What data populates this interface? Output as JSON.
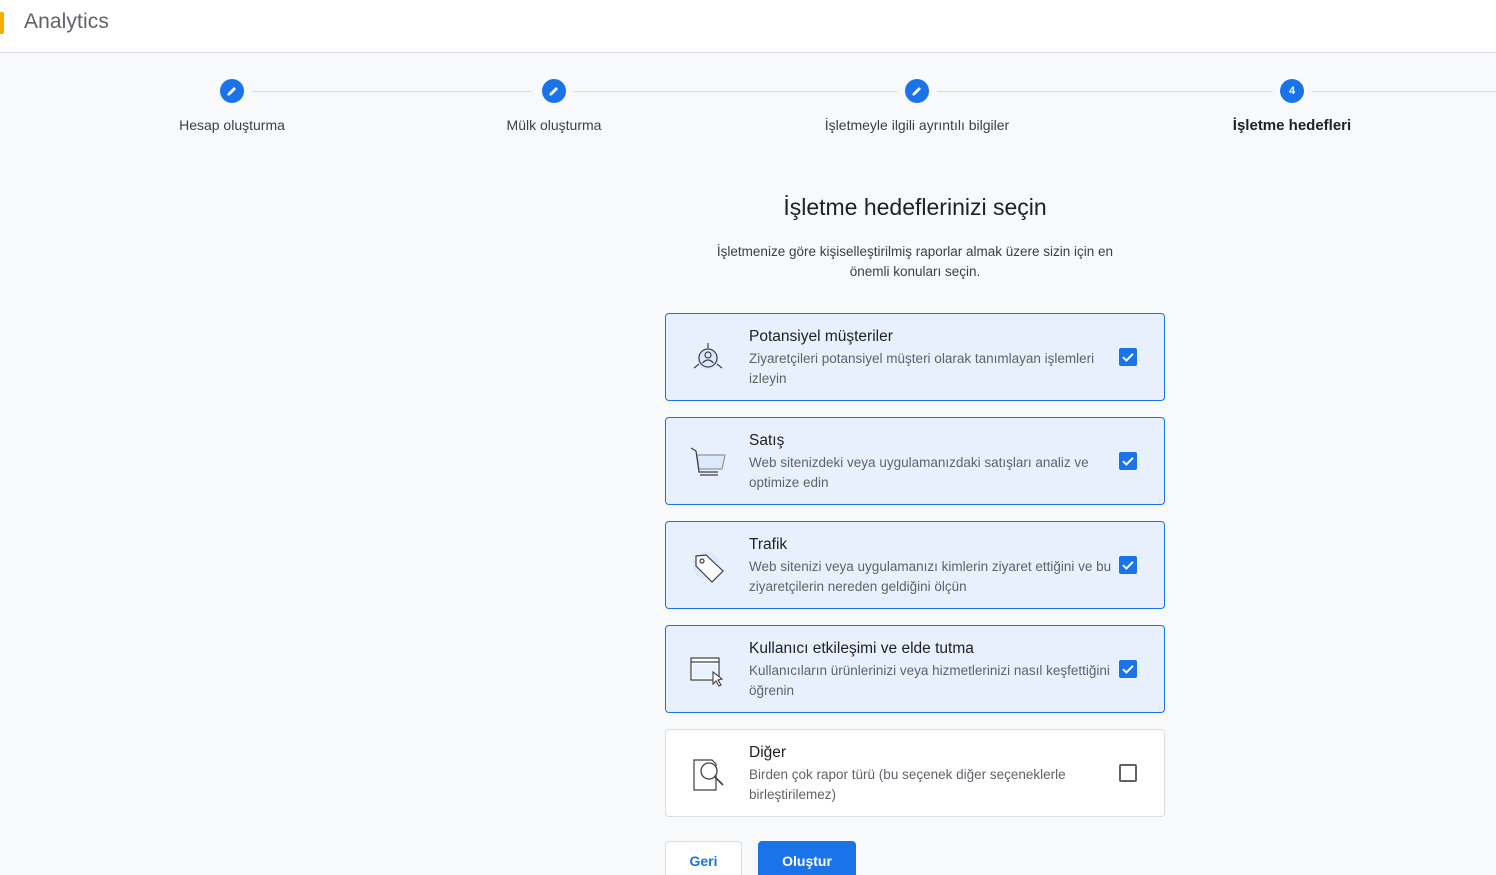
{
  "app": {
    "title": "Analytics"
  },
  "stepper": {
    "steps": [
      {
        "label": "Hesap oluşturma",
        "state": "completed"
      },
      {
        "label": "Mülk oluşturma",
        "state": "completed"
      },
      {
        "label": "İşletmeyle ilgili ayrıntılı bilgiler",
        "state": "completed"
      },
      {
        "label": "İşletme hedefleri",
        "state": "current",
        "number": "4"
      }
    ]
  },
  "main": {
    "heading": "İşletme hedeflerinizi seçin",
    "subheading": "İşletmenize göre kişiselleştirilmiş raporlar almak üzere sizin için en önemli konuları seçin."
  },
  "options": [
    {
      "title": "Potansiyel müşteriler",
      "description": "Ziyaretçileri potansiyel müşteri olarak tanımlayan işlemleri izleyin",
      "checked": true,
      "icon": "leads-target-icon"
    },
    {
      "title": "Satış",
      "description": "Web sitenizdeki veya uygulamanızdaki satışları analiz ve optimize edin",
      "checked": true,
      "icon": "shopping-cart-icon"
    },
    {
      "title": "Trafik",
      "description": "Web sitenizi veya uygulamanızı kimlerin ziyaret ettiğini ve bu ziyaretçilerin nereden geldiğini ölçün",
      "checked": true,
      "icon": "tag-icon"
    },
    {
      "title": "Kullanıcı etkileşimi ve elde tutma",
      "description": "Kullanıcıların ürünlerinizi veya hizmetlerinizi nasıl keşfettiğini öğrenin",
      "checked": true,
      "icon": "browser-cursor-icon"
    },
    {
      "title": "Diğer",
      "description": "Birden çok rapor türü (bu seçenek diğer seçeneklerle birleştirilemez)",
      "checked": false,
      "icon": "document-search-icon"
    }
  ],
  "buttons": {
    "back": "Geri",
    "create": "Oluştur"
  },
  "colors": {
    "accent": "#1a73e8",
    "brand": "#f9ab00",
    "selected_bg": "#e8f0fe"
  }
}
